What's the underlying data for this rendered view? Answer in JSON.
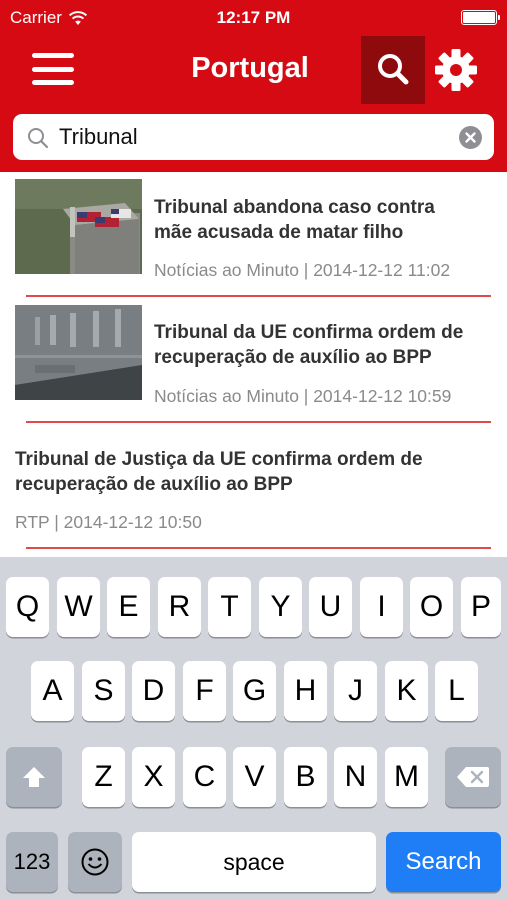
{
  "status_bar": {
    "carrier": "Carrier",
    "time": "12:17 PM"
  },
  "nav": {
    "title": "Portugal"
  },
  "search": {
    "value": "Tribunal"
  },
  "articles": [
    {
      "title_line1": "Tribunal abandona caso contra",
      "title_line2": "mãe acusada de matar filho",
      "meta": "Notícias ao Minuto | 2014-12-12 11:02"
    },
    {
      "title_line1": "Tribunal da UE confirma ordem de",
      "title_line2": "recuperação de auxílio ao BPP",
      "meta": "Notícias ao Minuto | 2014-12-12 10:59"
    },
    {
      "title_line1": "Tribunal de Justiça da UE confirma ordem de",
      "title_line2": "recuperação de auxílio ao BPP",
      "meta": "RTP | 2014-12-12 10:50"
    }
  ],
  "keyboard": {
    "row1": [
      "Q",
      "W",
      "E",
      "R",
      "T",
      "Y",
      "U",
      "I",
      "O",
      "P"
    ],
    "row2": [
      "A",
      "S",
      "D",
      "F",
      "G",
      "H",
      "J",
      "K",
      "L"
    ],
    "row3": [
      "Z",
      "X",
      "C",
      "V",
      "B",
      "N",
      "M"
    ],
    "numbers_key": "123",
    "space_key": "space",
    "search_key": "Search"
  },
  "colors": {
    "brand_red": "#d60a12",
    "active_dark_red": "#8e0a0c",
    "divider": "#e04a4a",
    "key_blue": "#1f7ef5"
  }
}
